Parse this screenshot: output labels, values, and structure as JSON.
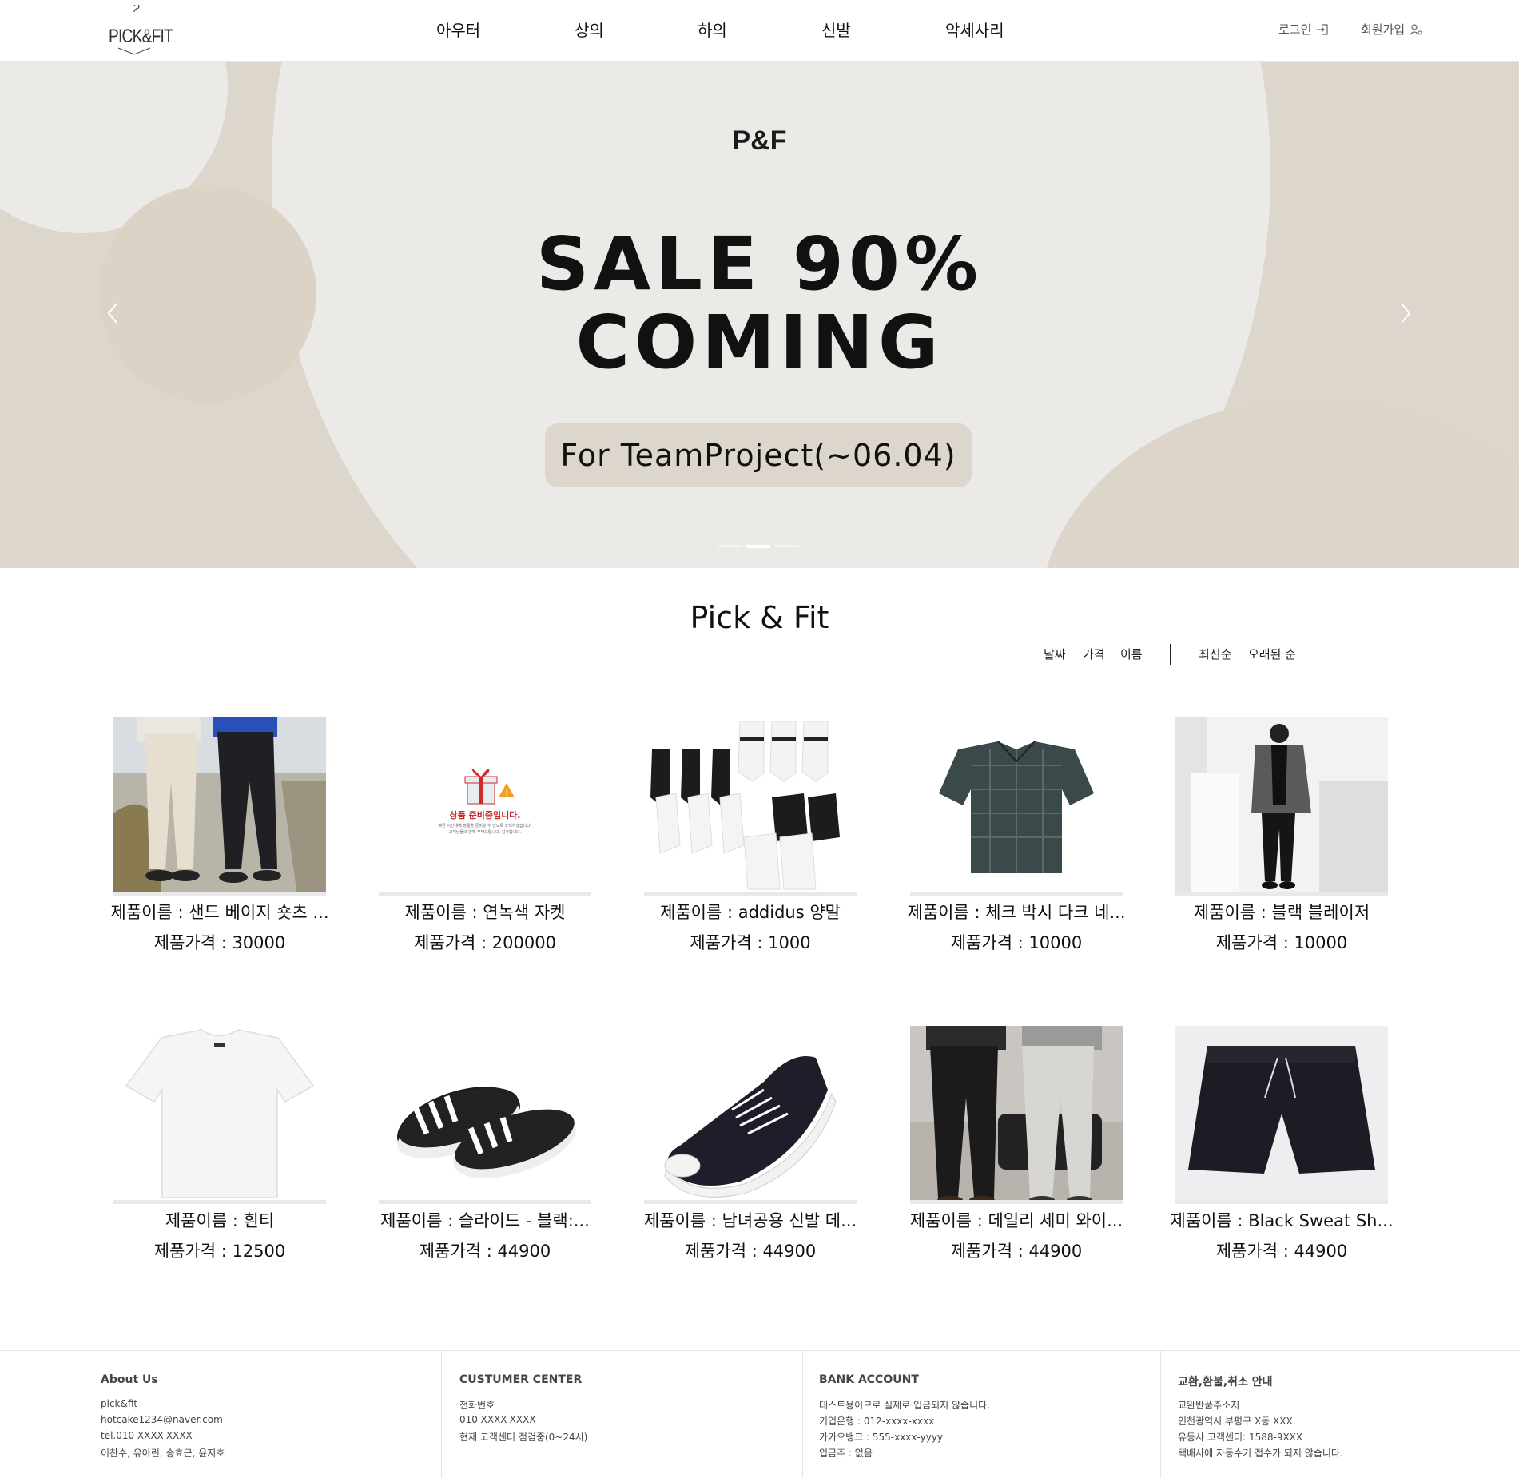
{
  "header": {
    "logo_text": "PICK&FIT",
    "nav": [
      "아우터",
      "상의",
      "하의",
      "신발",
      "악세사리"
    ],
    "login_label": "로그인",
    "signup_label": "회원가입"
  },
  "banner": {
    "brand": "P&F",
    "headline_1": "SALE 90%",
    "headline_2": "COMING",
    "pill_text": "For TeamProject(~06.04)",
    "slide_count": 3,
    "active_slide": 2
  },
  "section": {
    "title": "Pick & Fit",
    "sort_keys": [
      "날짜",
      "가격",
      "이름"
    ],
    "sort_orders": [
      "최신순",
      "오래된 순"
    ]
  },
  "products": [
    {
      "name": "제품이름 : 샌드 베이지 숏츠 ...",
      "price": "제품가격 : 30000",
      "image": "beige-pants-photo"
    },
    {
      "name": "제품이름 : 연녹색 자켓",
      "price": "제품가격 : 200000",
      "image": "preparing-gift-placeholder"
    },
    {
      "name": "제품이름 : addidus 양말",
      "price": "제품가격 : 1000",
      "image": "socks-photo"
    },
    {
      "name": "제품이름 : 체크 박시 다크 네...",
      "price": "제품가격 : 10000",
      "image": "check-shirt-photo"
    },
    {
      "name": "제품이름 : 블랙 블레이저",
      "price": "제품가격 : 10000",
      "image": "black-blazer-photo"
    },
    {
      "name": "제품이름 : 흰티",
      "price": "제품가격 : 12500",
      "image": "white-tshirt-photo"
    },
    {
      "name": "제품이름 : 슬라이드 - 블랙:...",
      "price": "제품가격 : 44900",
      "image": "slide-sandal-photo"
    },
    {
      "name": "제품이름 : 남녀공용 신발 데...",
      "price": "제품가격 : 44900",
      "image": "canvas-sneaker-photo"
    },
    {
      "name": "제품이름 : 데일리 세미 와이...",
      "price": "제품가격 : 44900",
      "image": "wide-pants-photo"
    },
    {
      "name": "제품이름 : Black Sweat Sh...",
      "price": "제품가격 : 44900",
      "image": "sweat-shorts-photo"
    }
  ],
  "placeholder_text": {
    "main": "상품 준비중입니다.",
    "sub_1": "빠른 시간내에 정품을 준비할 수 있도록 노력하겠습니다.",
    "sub_2": "고객님들의 양해 부탁드립니다. 감사합니다."
  },
  "footer": {
    "about": {
      "title": "About Us",
      "lines": [
        "pick&fit",
        "hotcake1234@naver.com",
        "tel.010-XXXX-XXXX",
        "이찬수, 유아린, 송효근, 윤지호"
      ]
    },
    "center": {
      "title": "CUSTUMER CENTER",
      "lines": [
        "전화번호",
        "010-XXXX-XXXX",
        "현재 고객센터 점검중(0~24시)"
      ]
    },
    "bank": {
      "title": "BANK ACCOUNT",
      "lines": [
        "테스트용이므로 실제로 입금되지 않습니다.",
        "기업은행 : 012-xxxx-xxxx",
        "카카오뱅크 : 555-xxxx-yyyy",
        "입금주 : 없음"
      ]
    },
    "exchange": {
      "title": "교환,환불,취소 안내",
      "lines": [
        "교완반품주소지",
        "인천광역시 부평구 X동 XXX",
        "유동사 고객센터: 1588-9XXX",
        "택배사에 자동수기 접수가 되지 않습니다."
      ]
    }
  }
}
